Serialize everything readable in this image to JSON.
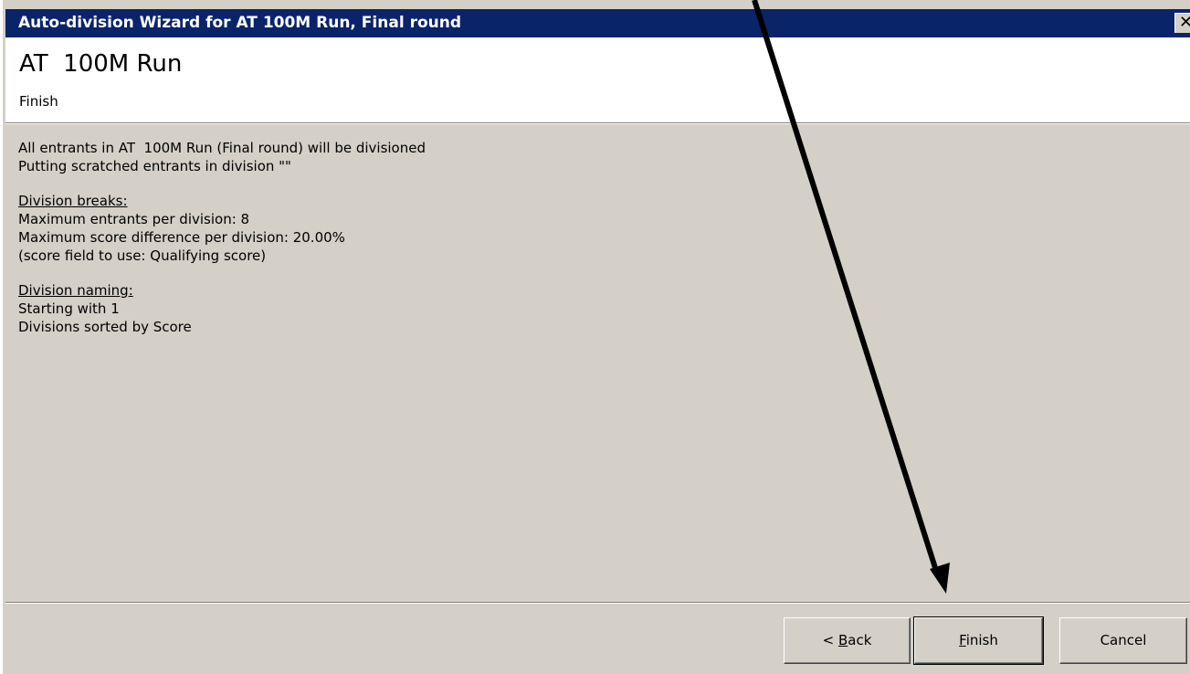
{
  "window": {
    "title": "Auto-division Wizard for AT  100M Run, Final round",
    "close_glyph": "✕"
  },
  "header": {
    "title": "AT  100M Run",
    "subtitle": "Finish"
  },
  "summary": {
    "line1": "All entrants in AT  100M Run (Final round) will be divisioned",
    "line2": "Putting scratched entrants in division \"\"",
    "breaks_heading": "Division breaks:",
    "max_entrants": "Maximum entrants per division: 8",
    "max_score_diff": "Maximum score difference per division: 20.00%",
    "score_field": "(score field to use: Qualifying score)",
    "naming_heading": "Division naming:",
    "starting_with": "Starting with 1",
    "sorted_by": "Divisions sorted by Score"
  },
  "buttons": {
    "back_prefix": "< ",
    "back_mnemonic": "B",
    "back_rest": "ack",
    "finish_mnemonic": "F",
    "finish_rest": "inish",
    "cancel": "Cancel"
  },
  "annotation": {
    "type": "arrow",
    "color": "#000000",
    "points_to": "finish-button"
  }
}
